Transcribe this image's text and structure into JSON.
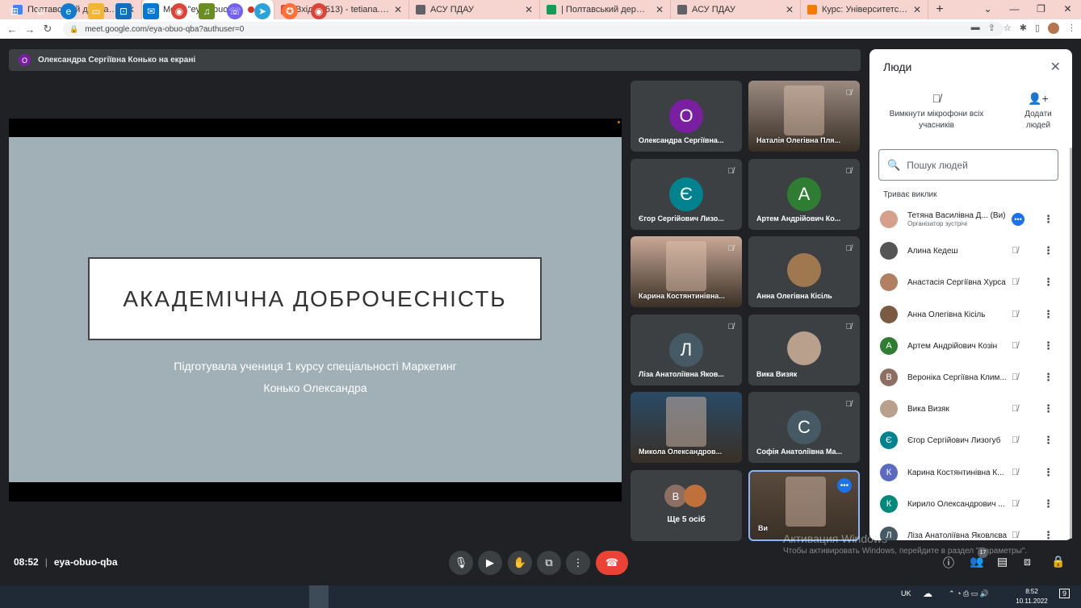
{
  "browser": {
    "tabs": [
      {
        "title": "Полтавський державний аграр",
        "color": "#4285f4"
      },
      {
        "title": "Meet: \"eya-obuo-qba\"",
        "color": "#00897b",
        "active": true,
        "recording": true
      },
      {
        "title": "Вхідні (513) - tetiana.diadyk@p",
        "color": "#ea4335"
      },
      {
        "title": "АСУ ПДАУ",
        "color": "#5f6368"
      },
      {
        "title": "| Полтавський державний агра",
        "color": "#0f9d58"
      },
      {
        "title": "АСУ ПДАУ",
        "color": "#5f6368"
      },
      {
        "title": "Курс: Університетська освіта_",
        "color": "#f57c00"
      }
    ],
    "url": "meet.google.com/eya-obuo-qba?authuser=0"
  },
  "presenter_bar": {
    "avatar_letter": "О",
    "text": "Олександра Сергіївна Конько на екрані"
  },
  "slide": {
    "title": "АКАДЕМІЧНА ДОБРОЧЕСНІСТЬ",
    "subtitle1": "Підготувала учениця 1 курсу спеціальності Маркетинг",
    "subtitle2": "Конько Олександра"
  },
  "tiles": [
    {
      "name": "Олександра Сергіївна...",
      "letter": "О",
      "color": "#7b1fa2",
      "muted": false
    },
    {
      "name": "Наталія Олегівна Пля...",
      "muted": true,
      "video": true,
      "bg": "#9a8a80"
    },
    {
      "name": "Єгор Сергійович Лизо...",
      "letter": "Є",
      "color": "#00838f",
      "muted": true
    },
    {
      "name": "Артем Андрійович Ко...",
      "letter": "А",
      "color": "#2e7d32",
      "muted": true
    },
    {
      "name": "Карина Костянтинівна...",
      "muted": true,
      "video": true,
      "bg": "#c8a896"
    },
    {
      "name": "Анна Олегівна Кісіль",
      "muted": true,
      "photo": "#a07850"
    },
    {
      "name": "Ліза Анатоліївна Яков...",
      "letter": "Л",
      "color": "#455a64",
      "muted": true
    },
    {
      "name": "Вика Визяк",
      "muted": true,
      "photo": "#b9a08c"
    },
    {
      "name": "Микола Олександров...",
      "muted": false,
      "video": true,
      "bg": "#2a4a66"
    },
    {
      "name": "Софія Анатоліївна Ма...",
      "letter": "С",
      "color": "#455a64",
      "muted": true
    },
    {
      "more_label": "Ще 5 осіб",
      "letter": "В",
      "color": "#8d6e63"
    },
    {
      "name": "Ви",
      "self": true,
      "video": true,
      "bg": "#5a4a3e"
    }
  ],
  "bottom": {
    "time": "08:52",
    "meeting_code": "eya-obuo-qba",
    "people_count": "17"
  },
  "watermark": {
    "line1": "Активация Windows",
    "line2": "Чтобы активировать Windows, перейдите в раздел \"Параметры\"."
  },
  "people_panel": {
    "title": "Люди",
    "mute_all": "Вимкнути мікрофони всіх учасників",
    "add_people": "Додати людей",
    "search_placeholder": "Пошук людей",
    "section": "Триває виклик",
    "people": [
      {
        "name": "Тетяна Василівна Д...  (Ви)",
        "sub": "Організатор зустрічі",
        "photo": "#d6a08a",
        "self": true
      },
      {
        "name": "Алина Кедеш",
        "photo": "#555"
      },
      {
        "name": "Анастасія Сергіївна Хурса",
        "photo": "#b08060"
      },
      {
        "name": "Анна Олегівна Кісіль",
        "photo": "#7a5a40"
      },
      {
        "name": "Артем Андрійович Козін",
        "letter": "А",
        "color": "#2e7d32"
      },
      {
        "name": "Вероніка Сергіївна Клим...",
        "letter": "В",
        "color": "#8d6e63"
      },
      {
        "name": "Вика Визяк",
        "photo": "#b9a08c"
      },
      {
        "name": "Єгор Сергійович Лизогуб",
        "letter": "Є",
        "color": "#00838f"
      },
      {
        "name": "Карина Костянтинівна К...",
        "letter": "К",
        "color": "#5c6bc0"
      },
      {
        "name": "Кирило Олександрович ...",
        "letter": "К",
        "color": "#00897b"
      },
      {
        "name": "Ліза Анатоліївна Яковлєва",
        "letter": "Л",
        "color": "#455a64"
      }
    ]
  },
  "taskbar": {
    "lang": "UK",
    "time": "8:52",
    "date": "10.11.2022",
    "notif": "9"
  }
}
